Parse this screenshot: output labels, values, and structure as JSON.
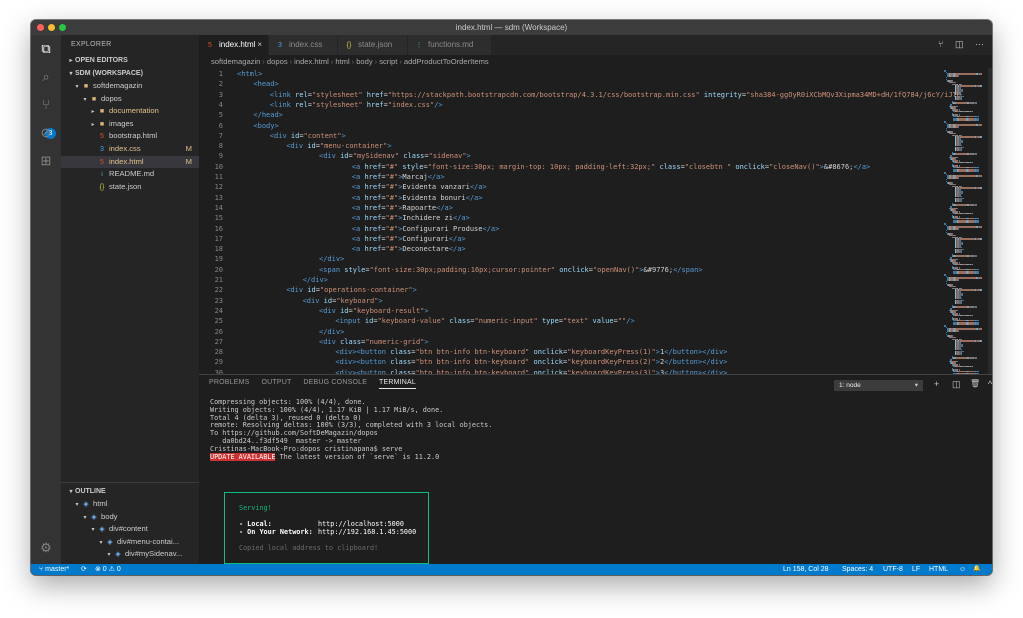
{
  "window": {
    "title": "index.html — sdm (Workspace)"
  },
  "activity": {
    "explorer": "⧉",
    "search": "⌕",
    "scm": "⑂",
    "scm_badge": "3",
    "debug": "⊘",
    "extensions": "⊞",
    "settings": "⚙"
  },
  "sidebar": {
    "title": "EXPLORER",
    "open_editors": "OPEN EDITORS",
    "workspace": "SDM (WORKSPACE)",
    "tree": [
      {
        "label": "softdemagazin",
        "icon": "folder",
        "indent": 1,
        "twist": "▾",
        "git": ""
      },
      {
        "label": "dopos",
        "icon": "folder",
        "indent": 2,
        "twist": "▾",
        "git": ""
      },
      {
        "label": "documentation",
        "icon": "folder",
        "indent": 3,
        "twist": "▸",
        "git": "",
        "modified": true
      },
      {
        "label": "images",
        "icon": "folder",
        "indent": 3,
        "twist": "▸",
        "git": ""
      },
      {
        "label": "bootstrap.html",
        "icon": "html",
        "indent": 3,
        "twist": "",
        "git": ""
      },
      {
        "label": "index.css",
        "icon": "css",
        "indent": 3,
        "twist": "",
        "git": "M",
        "modified": true
      },
      {
        "label": "index.html",
        "icon": "html",
        "indent": 3,
        "twist": "",
        "git": "M",
        "modified": true,
        "selected": true
      },
      {
        "label": "README.md",
        "icon": "md",
        "indent": 3,
        "twist": "",
        "git": ""
      },
      {
        "label": "state.json",
        "icon": "json",
        "indent": 3,
        "twist": "",
        "git": ""
      }
    ],
    "outline_title": "OUTLINE",
    "outline": [
      {
        "label": "html",
        "indent": 1
      },
      {
        "label": "body",
        "indent": 2
      },
      {
        "label": "div#content",
        "indent": 3
      },
      {
        "label": "div#menu-contai...",
        "indent": 4
      },
      {
        "label": "div#mySidenav...",
        "indent": 5
      }
    ]
  },
  "tabs": [
    {
      "label": "index.html",
      "icon": "html",
      "active": true,
      "close": "×"
    },
    {
      "label": "index.css",
      "icon": "css",
      "active": false
    },
    {
      "label": "state.json",
      "icon": "json",
      "active": false
    },
    {
      "label": "functions.md",
      "icon": "md",
      "active": false
    }
  ],
  "tab_actions": [
    "⑂",
    "◫",
    "···"
  ],
  "breadcrumb": [
    "softdemagazin",
    "dopos",
    "index.html",
    "html",
    "body",
    "script",
    "addProductToOrderItems"
  ],
  "code": [
    {
      "n": "1",
      "i": 0,
      "s": [
        [
          "t",
          "<html>"
        ]
      ]
    },
    {
      "n": "2",
      "i": 1,
      "s": [
        [
          "t",
          "<head>"
        ]
      ]
    },
    {
      "n": "3",
      "i": 2,
      "s": [
        [
          "t",
          "<link "
        ],
        [
          "a",
          "rel"
        ],
        [
          "x",
          "="
        ],
        [
          "s",
          "\"stylesheet\""
        ],
        [
          "a",
          " href"
        ],
        [
          "x",
          "="
        ],
        [
          "s",
          "\"https://stackpath.bootstrapcdn.com/bootstrap/4.3.1/css/bootstrap.min.css\""
        ],
        [
          "a",
          " integrity"
        ],
        [
          "x",
          "="
        ],
        [
          "s",
          "\"sha384-ggOyR0iXCbMQv3Xipma34MD+dH/1fQ784/j6cY/iJTQ"
        ]
      ]
    },
    {
      "n": "4",
      "i": 2,
      "s": [
        [
          "t",
          "<link "
        ],
        [
          "a",
          "rel"
        ],
        [
          "x",
          "="
        ],
        [
          "s",
          "\"stylesheet\""
        ],
        [
          "a",
          " href"
        ],
        [
          "x",
          "="
        ],
        [
          "s",
          "\"index.css\""
        ],
        [
          "t",
          "/>"
        ]
      ]
    },
    {
      "n": "5",
      "i": 1,
      "s": [
        [
          "t",
          "</head>"
        ]
      ]
    },
    {
      "n": "6",
      "i": 1,
      "s": [
        [
          "t",
          "<body>"
        ]
      ]
    },
    {
      "n": "7",
      "i": 2,
      "s": [
        [
          "t",
          "<div "
        ],
        [
          "a",
          "id"
        ],
        [
          "x",
          "="
        ],
        [
          "s",
          "\"content\""
        ],
        [
          "t",
          ">"
        ]
      ]
    },
    {
      "n": "8",
      "i": 3,
      "s": [
        [
          "t",
          "<div "
        ],
        [
          "a",
          "id"
        ],
        [
          "x",
          "="
        ],
        [
          "s",
          "\"menu-container\""
        ],
        [
          "t",
          ">"
        ]
      ]
    },
    {
      "n": "9",
      "i": 5,
      "s": [
        [
          "t",
          "<div "
        ],
        [
          "a",
          "id"
        ],
        [
          "x",
          "="
        ],
        [
          "s",
          "\"mySidenav\""
        ],
        [
          "a",
          " class"
        ],
        [
          "x",
          "="
        ],
        [
          "s",
          "\"sidenav\""
        ],
        [
          "t",
          ">"
        ]
      ]
    },
    {
      "n": "10",
      "i": 7,
      "s": [
        [
          "t",
          "<a "
        ],
        [
          "a",
          "href"
        ],
        [
          "x",
          "="
        ],
        [
          "s",
          "\"#\""
        ],
        [
          "a",
          " style"
        ],
        [
          "x",
          "="
        ],
        [
          "s",
          "\"font-size:30px; margin-top: 10px; padding-left:32px;\""
        ],
        [
          "a",
          " class"
        ],
        [
          "x",
          "="
        ],
        [
          "s",
          "\"closebtn \""
        ],
        [
          "a",
          " onclick"
        ],
        [
          "x",
          "="
        ],
        [
          "s",
          "\"closeNav()\""
        ],
        [
          "t",
          ">"
        ],
        [
          "e",
          "&#8676;"
        ],
        [
          "t",
          "</a>"
        ]
      ]
    },
    {
      "n": "11",
      "i": 7,
      "s": [
        [
          "t",
          "<a "
        ],
        [
          "a",
          "href"
        ],
        [
          "x",
          "="
        ],
        [
          "s",
          "\"#\""
        ],
        [
          "t",
          ">"
        ],
        [
          "x",
          "Marcaj"
        ],
        [
          "t",
          "</a>"
        ]
      ]
    },
    {
      "n": "12",
      "i": 7,
      "s": [
        [
          "t",
          "<a "
        ],
        [
          "a",
          "href"
        ],
        [
          "x",
          "="
        ],
        [
          "s",
          "\"#\""
        ],
        [
          "t",
          ">"
        ],
        [
          "x",
          "Evidenta vanzari"
        ],
        [
          "t",
          "</a>"
        ]
      ]
    },
    {
      "n": "13",
      "i": 7,
      "s": [
        [
          "t",
          "<a "
        ],
        [
          "a",
          "href"
        ],
        [
          "x",
          "="
        ],
        [
          "s",
          "\"#\""
        ],
        [
          "t",
          ">"
        ],
        [
          "x",
          "Evidenta bonuri"
        ],
        [
          "t",
          "</a>"
        ]
      ]
    },
    {
      "n": "14",
      "i": 7,
      "s": [
        [
          "t",
          "<a "
        ],
        [
          "a",
          "href"
        ],
        [
          "x",
          "="
        ],
        [
          "s",
          "\"#\""
        ],
        [
          "t",
          ">"
        ],
        [
          "x",
          "Rapoarte"
        ],
        [
          "t",
          "</a>"
        ]
      ]
    },
    {
      "n": "15",
      "i": 7,
      "s": [
        [
          "t",
          "<a "
        ],
        [
          "a",
          "href"
        ],
        [
          "x",
          "="
        ],
        [
          "s",
          "\"#\""
        ],
        [
          "t",
          ">"
        ],
        [
          "x",
          "Inchidere zi"
        ],
        [
          "t",
          "</a>"
        ]
      ]
    },
    {
      "n": "16",
      "i": 7,
      "s": [
        [
          "t",
          "<a "
        ],
        [
          "a",
          "href"
        ],
        [
          "x",
          "="
        ],
        [
          "s",
          "\"#\""
        ],
        [
          "t",
          ">"
        ],
        [
          "x",
          "Configurari Produse"
        ],
        [
          "t",
          "</a>"
        ]
      ]
    },
    {
      "n": "17",
      "i": 7,
      "s": [
        [
          "t",
          "<a "
        ],
        [
          "a",
          "href"
        ],
        [
          "x",
          "="
        ],
        [
          "s",
          "\"#\""
        ],
        [
          "t",
          ">"
        ],
        [
          "x",
          "Configurari"
        ],
        [
          "t",
          "</a>"
        ]
      ]
    },
    {
      "n": "18",
      "i": 7,
      "s": [
        [
          "t",
          "<a "
        ],
        [
          "a",
          "href"
        ],
        [
          "x",
          "="
        ],
        [
          "s",
          "\"#\""
        ],
        [
          "t",
          ">"
        ],
        [
          "x",
          "Deconectare"
        ],
        [
          "t",
          "</a>"
        ]
      ]
    },
    {
      "n": "19",
      "i": 5,
      "s": [
        [
          "t",
          "</div>"
        ]
      ]
    },
    {
      "n": "20",
      "i": 5,
      "s": [
        [
          "t",
          "<span "
        ],
        [
          "a",
          "style"
        ],
        [
          "x",
          "="
        ],
        [
          "s",
          "\"font-size:30px;padding:16px;cursor:pointer\""
        ],
        [
          "a",
          " onclick"
        ],
        [
          "x",
          "="
        ],
        [
          "s",
          "\"openNav()\""
        ],
        [
          "t",
          ">"
        ],
        [
          "e",
          "&#9776;"
        ],
        [
          "t",
          "</span>"
        ]
      ]
    },
    {
      "n": "21",
      "i": 4,
      "s": [
        [
          "t",
          "</div>"
        ]
      ]
    },
    {
      "n": "22",
      "i": 3,
      "s": [
        [
          "t",
          "<div "
        ],
        [
          "a",
          "id"
        ],
        [
          "x",
          "="
        ],
        [
          "s",
          "\"operations-container\""
        ],
        [
          "t",
          ">"
        ]
      ]
    },
    {
      "n": "23",
      "i": 4,
      "s": [
        [
          "t",
          "<div "
        ],
        [
          "a",
          "id"
        ],
        [
          "x",
          "="
        ],
        [
          "s",
          "\"keyboard\""
        ],
        [
          "t",
          ">"
        ]
      ]
    },
    {
      "n": "24",
      "i": 5,
      "s": [
        [
          "t",
          "<div "
        ],
        [
          "a",
          "id"
        ],
        [
          "x",
          "="
        ],
        [
          "s",
          "\"keyboard-result\""
        ],
        [
          "t",
          ">"
        ]
      ]
    },
    {
      "n": "25",
      "i": 6,
      "s": [
        [
          "t",
          "<input "
        ],
        [
          "a",
          "id"
        ],
        [
          "x",
          "="
        ],
        [
          "s",
          "\"keyboard-value\""
        ],
        [
          "a",
          " class"
        ],
        [
          "x",
          "="
        ],
        [
          "s",
          "\"numeric-input\""
        ],
        [
          "a",
          " type"
        ],
        [
          "x",
          "="
        ],
        [
          "s",
          "\"text\""
        ],
        [
          "a",
          " value"
        ],
        [
          "x",
          "="
        ],
        [
          "s",
          "\"\""
        ],
        [
          "t",
          "/>"
        ]
      ]
    },
    {
      "n": "26",
      "i": 5,
      "s": [
        [
          "t",
          "</div>"
        ]
      ]
    },
    {
      "n": "27",
      "i": 5,
      "s": [
        [
          "t",
          "<div "
        ],
        [
          "a",
          "class"
        ],
        [
          "x",
          "="
        ],
        [
          "s",
          "\"numeric-grid\""
        ],
        [
          "t",
          ">"
        ]
      ]
    },
    {
      "n": "28",
      "i": 6,
      "s": [
        [
          "t",
          "<div><button "
        ],
        [
          "a",
          "class"
        ],
        [
          "x",
          "="
        ],
        [
          "s",
          "\"btn btn-info btn-keyboard\""
        ],
        [
          "a",
          " onclick"
        ],
        [
          "x",
          "="
        ],
        [
          "s",
          "\"keyboardKeyPress(1)\""
        ],
        [
          "t",
          ">"
        ],
        [
          "x",
          "1"
        ],
        [
          "t",
          "</button></div>"
        ]
      ]
    },
    {
      "n": "29",
      "i": 6,
      "s": [
        [
          "t",
          "<div><button "
        ],
        [
          "a",
          "class"
        ],
        [
          "x",
          "="
        ],
        [
          "s",
          "\"btn btn-info btn-keyboard\""
        ],
        [
          "a",
          " onclick"
        ],
        [
          "x",
          "="
        ],
        [
          "s",
          "\"keyboardKeyPress(2)\""
        ],
        [
          "t",
          ">"
        ],
        [
          "x",
          "2"
        ],
        [
          "t",
          "</button></div>"
        ]
      ]
    },
    {
      "n": "30",
      "i": 6,
      "s": [
        [
          "t",
          "<div><button "
        ],
        [
          "a",
          "class"
        ],
        [
          "x",
          "="
        ],
        [
          "s",
          "\"btn btn-info btn-keyboard\""
        ],
        [
          "a",
          " onclick"
        ],
        [
          "x",
          "="
        ],
        [
          "s",
          "\"keyboardKeyPress(3)\""
        ],
        [
          "t",
          ">"
        ],
        [
          "x",
          "3"
        ],
        [
          "t",
          "</button></div>"
        ]
      ]
    }
  ],
  "panel": {
    "tabs": [
      "PROBLEMS",
      "OUTPUT",
      "DEBUG CONSOLE",
      "TERMINAL"
    ],
    "active_tab": "TERMINAL",
    "terminal_select": "1: node",
    "actions": [
      "+",
      "◫",
      "🗑",
      "^",
      "×"
    ],
    "terminal": [
      "Compressing objects: 100% (4/4), done.",
      "Writing objects: 100% (4/4), 1.17 KiB | 1.17 MiB/s, done.",
      "Total 4 (delta 3), reused 0 (delta 0)",
      "remote: Resolving deltas: 100% (3/3), completed with 3 local objects.",
      "To https://github.com/SoftDeMagazin/dopos",
      "   da0bd24..f3df549  master -> master",
      "Cristinas-MacBook-Pro:dopos cristinapana$ serve"
    ],
    "update_badge": "UPDATE AVAILABLE",
    "update_text": " The latest version of `serve` is 11.2.0",
    "serve": {
      "title": "Serving!",
      "local_label": "- Local:",
      "local_url": "http://localhost:5000",
      "network_label": "- On Your Network:",
      "network_url": "http://192.168.1.45:5000",
      "copied": "Copied local address to clipboard!"
    }
  },
  "statusbar": {
    "branch": "⑂ master*",
    "sync": "⟳",
    "problems": "⊗ 0 ⚠ 0",
    "position": "Ln 158, Col 28",
    "spaces": "Spaces: 4",
    "encoding": "UTF-8",
    "eol": "LF",
    "language": "HTML",
    "feedback": "☺",
    "bell": "🔔"
  },
  "colors": {
    "accent": "#007acc",
    "tag": "#569cd6",
    "attr": "#9cdcfe",
    "string": "#ce9178",
    "serve_border": "#0dbc79",
    "update_bg": "#cd3131"
  }
}
